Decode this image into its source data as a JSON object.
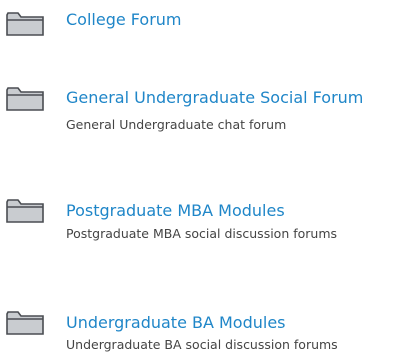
{
  "forums": [
    {
      "icon": "folder-icon",
      "title": "College Forum",
      "description": ""
    },
    {
      "icon": "folder-icon",
      "title": "General Undergraduate Social Forum",
      "description": "General Undergraduate chat forum"
    },
    {
      "icon": "folder-icon",
      "title": "Postgraduate MBA Modules",
      "description": "Postgraduate MBA social discussion forums"
    },
    {
      "icon": "folder-icon",
      "title": "Undergraduate BA Modules",
      "description": "Undergraduate BA social discussion forums"
    }
  ],
  "colors": {
    "link": "#1f86c8",
    "description": "#444444",
    "folder_fill": "#c9ccd0",
    "folder_stroke": "#4a4d52"
  }
}
